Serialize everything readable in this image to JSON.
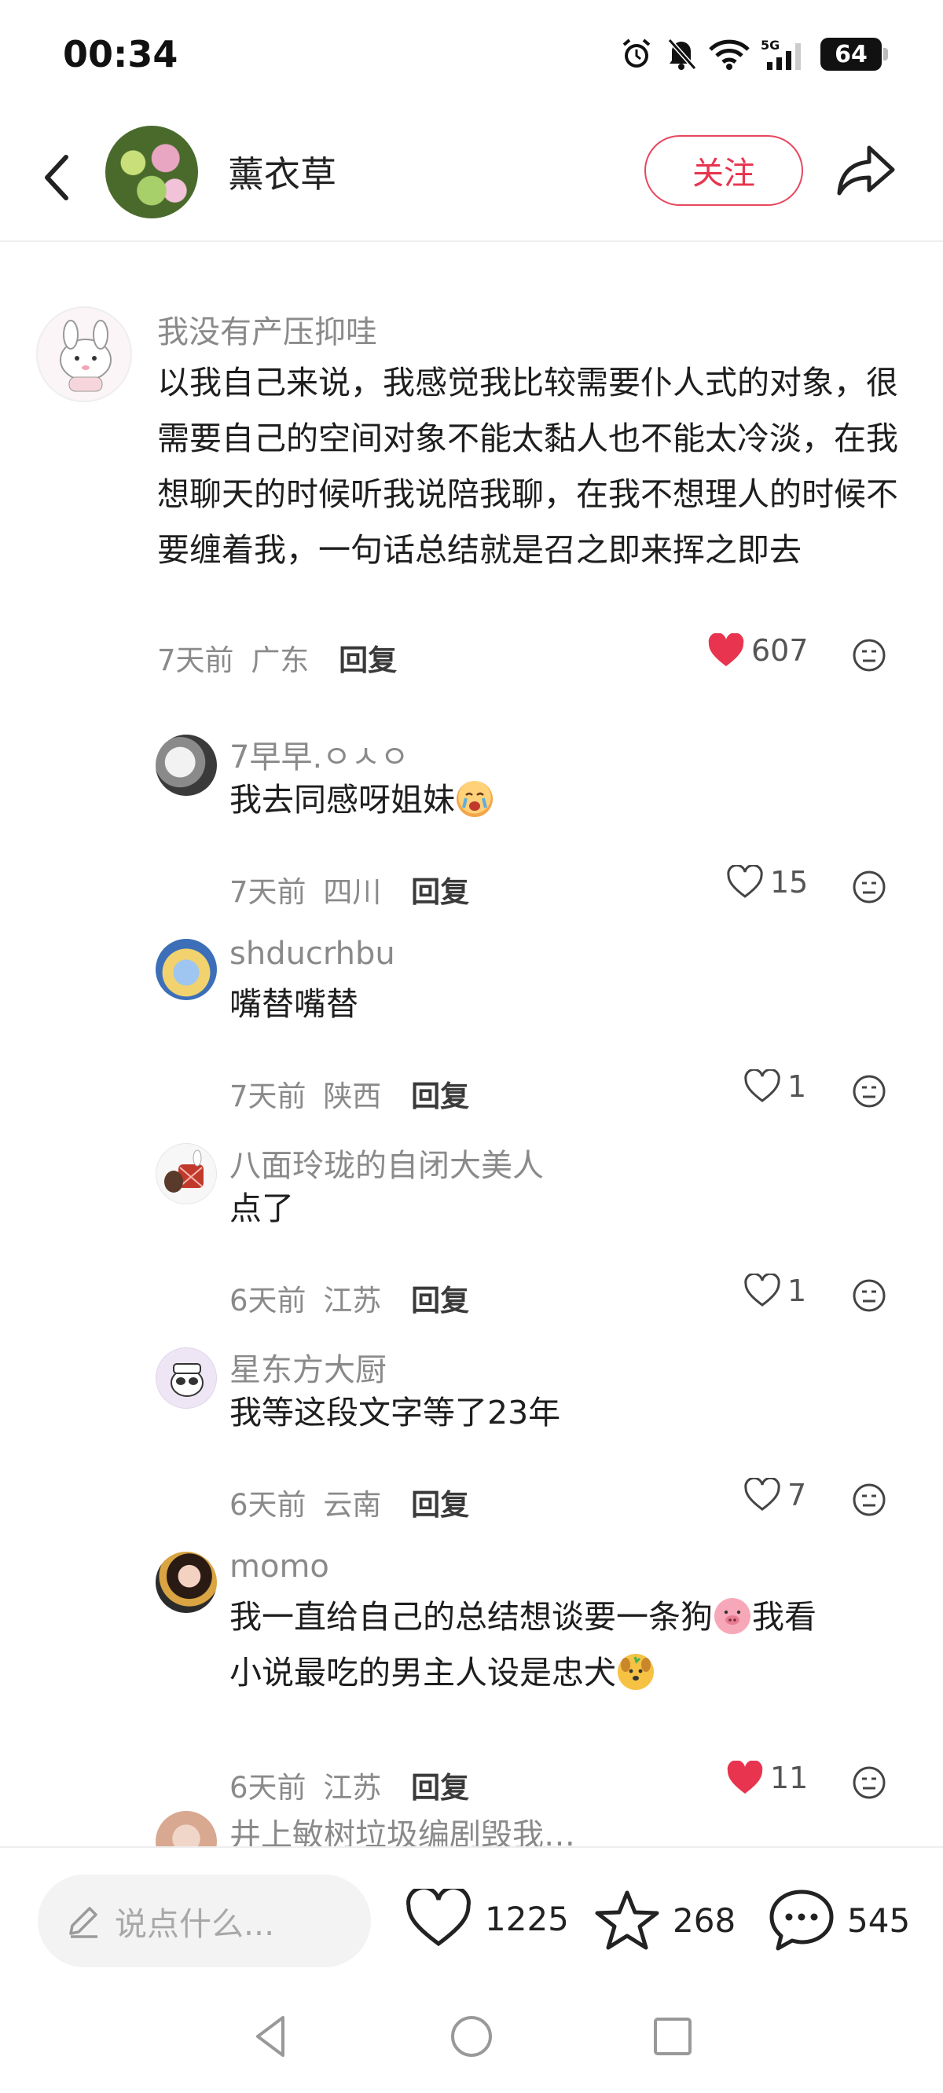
{
  "status_bar": {
    "time": "00:34",
    "battery": "64",
    "network": "5G",
    "icons": [
      "alarm-icon",
      "mute-bell-icon",
      "wifi-icon",
      "signal-icon",
      "battery-icon"
    ]
  },
  "header": {
    "author_name": "薰衣草",
    "follow_label": "关注",
    "icons": [
      "back-arrow-icon",
      "share-icon"
    ]
  },
  "comments": [
    {
      "user": "我没有产压抑哇",
      "text": "以我自己来说，我感觉我比较需要仆人式的对象，很需要自己的空间对象不能太黏人也不能太冷淡，在我想聊天的时候听我说陪我聊，在我不想理人的时候不要缠着我，一句话总结就是召之即来挥之即去",
      "time": "7天前",
      "location": "广东",
      "reply_label": "回复",
      "likes": "607",
      "liked": true
    },
    {
      "user": "7早早.ㅇㅅㅇ",
      "text": "我去同感呀姐妹",
      "emoji": "crying-face-emoji",
      "time": "7天前",
      "location": "四川",
      "reply_label": "回复",
      "likes": "15",
      "liked": false
    },
    {
      "user": "shducrhbu",
      "text": "嘴替嘴替",
      "time": "7天前",
      "location": "陕西",
      "reply_label": "回复",
      "likes": "1",
      "liked": false
    },
    {
      "user": "八面玲珑的自闭大美人",
      "text": "点了",
      "time": "6天前",
      "location": "江苏",
      "reply_label": "回复",
      "likes": "1",
      "liked": false
    },
    {
      "user": "星东方大厨",
      "text": "我等这段文字等了23年",
      "time": "6天前",
      "location": "云南",
      "reply_label": "回复",
      "likes": "7",
      "liked": false
    },
    {
      "user": "momo",
      "text_part1": "我一直给自己的总结想谈要一条狗",
      "text_part2": "我看",
      "text_line2": "小说最吃的男主人设是忠犬",
      "emojis": [
        "pig-face-emoji",
        "puppy-face-emoji"
      ],
      "time": "6天前",
      "location": "江苏",
      "reply_label": "回复",
      "likes": "11",
      "liked": true
    },
    {
      "user": "井上敏树垃圾编剧毁我…"
    }
  ],
  "bottom_bar": {
    "input_placeholder": "说点什么...",
    "like_count": "1225",
    "star_count": "268",
    "comment_count": "545"
  },
  "colors": {
    "accent_red": "#e8344f",
    "muted_text": "#8a8a8a",
    "body_text": "#1e1e1e"
  }
}
